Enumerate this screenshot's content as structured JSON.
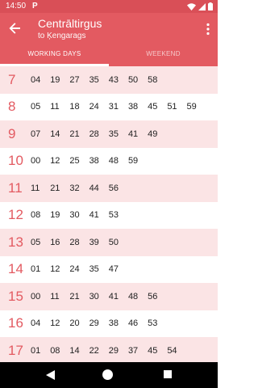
{
  "status_bar": {
    "time": "14:50",
    "app_icon": "P",
    "icons": [
      "wifi-icon",
      "signal-icon",
      "battery-icon"
    ]
  },
  "app_bar": {
    "title": "Centrāltirgus",
    "subtitle": "to Ķengarags",
    "back_icon": "arrow-back-icon",
    "menu_icon": "more-vert-icon"
  },
  "tabs": [
    {
      "label": "WORKING DAYS",
      "active": true
    },
    {
      "label": "WEEKEND",
      "active": false
    }
  ],
  "timetable": [
    {
      "hour": "7",
      "minutes": [
        "04",
        "19",
        "27",
        "35",
        "43",
        "50",
        "58"
      ]
    },
    {
      "hour": "8",
      "minutes": [
        "05",
        "11",
        "18",
        "24",
        "31",
        "38",
        "45",
        "51",
        "59"
      ]
    },
    {
      "hour": "9",
      "minutes": [
        "07",
        "14",
        "21",
        "28",
        "35",
        "41",
        "49"
      ]
    },
    {
      "hour": "10",
      "minutes": [
        "00",
        "12",
        "25",
        "38",
        "48",
        "59"
      ]
    },
    {
      "hour": "11",
      "minutes": [
        "11",
        "21",
        "32",
        "44",
        "56"
      ]
    },
    {
      "hour": "12",
      "minutes": [
        "08",
        "19",
        "30",
        "41",
        "53"
      ]
    },
    {
      "hour": "13",
      "minutes": [
        "05",
        "16",
        "28",
        "39",
        "50"
      ]
    },
    {
      "hour": "14",
      "minutes": [
        "01",
        "12",
        "24",
        "35",
        "47"
      ]
    },
    {
      "hour": "15",
      "minutes": [
        "00",
        "11",
        "21",
        "30",
        "41",
        "48",
        "56"
      ]
    },
    {
      "hour": "16",
      "minutes": [
        "04",
        "12",
        "20",
        "29",
        "38",
        "46",
        "53"
      ]
    },
    {
      "hour": "17",
      "minutes": [
        "01",
        "08",
        "14",
        "22",
        "29",
        "37",
        "45",
        "54"
      ]
    }
  ],
  "colors": {
    "primary": "#e35a61",
    "status_bar": "#d94f57",
    "row_alt": "#fbe4e5",
    "hour_text": "#e35a61"
  }
}
